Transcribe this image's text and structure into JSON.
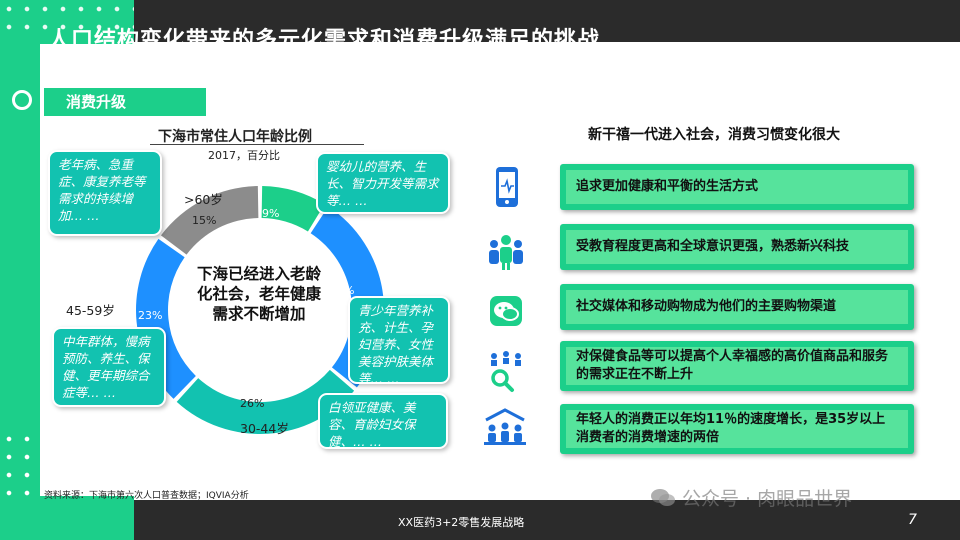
{
  "slide": {
    "title": "人口结构变化带来的多元化需求和消费升级满足的挑战",
    "section_tag": "消费升级",
    "footer_text": "XX医药3+2零售发展战略",
    "page_number": "7",
    "source_note": "资料来源：下海市第六次人口普查数据；IQVIA分析",
    "watermark": "公众号 · 肉眼品世界"
  },
  "colors": {
    "brand_green": "#1ccf8a",
    "card_inner_green": "#56e39c",
    "teal": "#12c2b0",
    "blue": "#1e90ff",
    "gray": "#8c8c8c",
    "dark": "#2b2b2b"
  },
  "chart_data": {
    "type": "pie",
    "title": "下海市常住人口年龄比例",
    "subtitle": "2017，百分比",
    "center_text": "下海已经进入老龄化社会，老年健康需求不断增加",
    "slices": [
      {
        "label": "",
        "value": 9,
        "display": "9%",
        "color": "#1ccf8a"
      },
      {
        "label": "",
        "value": 27,
        "display": "27%",
        "color": "#1e90ff"
      },
      {
        "label": "30-44岁",
        "value": 26,
        "display": "26%",
        "color": "#12c2b0"
      },
      {
        "label": "45-59岁",
        "value": 23,
        "display": "23%",
        "color": "#1e90ff"
      },
      {
        "label": ">60岁",
        "value": 15,
        "display": "15%",
        "color": "#8c8c8c"
      }
    ]
  },
  "left_bubbles": {
    "elderly": "老年病、急重症、康复养老等需求的持续增加… …",
    "infant": "婴幼儿的营养、生长、智力开发等需求等… …",
    "youth": "青少年营养补充、计生、孕妇营养、女性美容护肤美体等… …",
    "middle": "中年群体，慢病预防、养生、保健、更年期综合症等… …",
    "white_collar": "白领亚健康、美容、育龄妇女保健、… …"
  },
  "right_panel": {
    "heading": "新干禧一代进入社会，消费习惯变化很大",
    "items": [
      {
        "icon": "phone-heart-icon",
        "text": "追求更加健康和平衡的生活方式"
      },
      {
        "icon": "people-group-icon",
        "text": "受教育程度更高和全球意识更强，熟悉新兴科技"
      },
      {
        "icon": "chat-bubble-icon",
        "text": "社交媒体和移动购物成为他们的主要购物渠道"
      },
      {
        "icon": "magnifier-people-icon",
        "text": "对保健食品等可以提高个人幸福感的高价值商品和服务的需求正在不断上升"
      },
      {
        "icon": "audience-icon",
        "text": "年轻人的消费正以年均11％的速度增长，是35岁以上消费者的消费增速的两倍"
      }
    ]
  }
}
